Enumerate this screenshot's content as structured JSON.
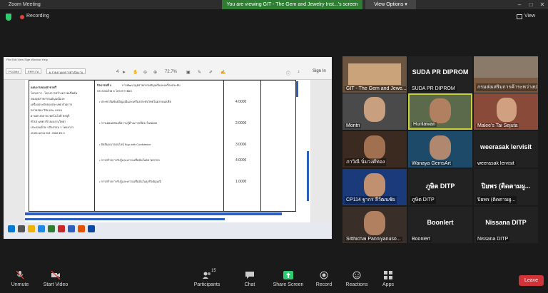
{
  "window": {
    "title": "Zoom Meeting",
    "share_banner": "You are viewing GIT - The Gem and Jewelry Inst...'s screen",
    "view_options": "View Options",
    "min": "–",
    "max": "□",
    "close": "✕"
  },
  "meeting": {
    "recording": "Recording",
    "view_label": "View"
  },
  "shared_doc": {
    "signin": "Sign In",
    "zoom_pct": "72.7%",
    "page_num": "4",
    "tab1": "PC0094",
    "tab2": "ERR ITA",
    "tab3": "ผ.รายงานผลการดำเนินงาน",
    "left_header": "แผนงานของสาขาตรี",
    "left_lines": [
      "โครงการ : โครงการสร้างความเชื่อมั่น",
      "ของอุตสาหกรรมอัญมณีและ",
      "เครื่องประดับของประเทศ ด้วยการ",
      "ตรวจสอบ วิจัย และ อบรม",
      "ผ่านทางหลาย เทคโนโลยี ชลบุรี",
      "ทั่วประเทศ สร้างผลงานวิทยา",
      "ประกอบด้วย ฯ กิจกรรม ฯ โครงการ",
      "งบประมาณ พ.ศ. 2566 ตร.3"
    ],
    "activity_header": "กิจกรรมที่ 3",
    "activity_title": "การพัฒนาอุตสาหกรรมอัญมณีและเครื่องประดับ",
    "activity_sub": "ประกอบด้วย 5 โครงการย่อย",
    "bullets": [
      "• ประชาสัมพันธ์อัญมณีและเครื่องประดับไทยในตลาดเอเชีย",
      "• การเผยแพร่องค์ความรู้ด้านการเจียระไนพลอย",
      "• จัดสัมมนาออนไลน์ Buy with Confidence",
      "• การสร้างการรับรู้และความเชื่อมั่นในตลาดสากล",
      "• การสร้างการรับรู้และความเชื่อมั่นในธุรกิจอัญมณี"
    ],
    "values": [
      "4.0000",
      "2.0000",
      "3.0000",
      "4.0000",
      "1.0000"
    ]
  },
  "participants": [
    {
      "name": "GIT - The Gem and Jewe...",
      "big": ""
    },
    {
      "name": "SUDA PR DIPROM",
      "big": "SUDA PR DIPROM"
    },
    {
      "name": "กรมส่งเสริมการค้าระหว่างประเทศ",
      "big": ""
    },
    {
      "name": "Montri",
      "big": ""
    },
    {
      "name": "Hunlawan",
      "big": ""
    },
    {
      "name": "Malee's Tai Sejuta",
      "big": ""
    },
    {
      "name": "ภาวิณี นิ่มวงศ์ทอง",
      "big": ""
    },
    {
      "name": "Wanaya GemsArt",
      "big": ""
    },
    {
      "name": "weerasak lervisit",
      "big": "weerasak lervisit"
    },
    {
      "name": "CP114 ฐากร ลีวัฒนชัย",
      "big": ""
    },
    {
      "name": "ภูษิต DITP",
      "big": "ภูษิต DITP"
    },
    {
      "name": "ปิยพร (ติดตามผู...",
      "big": "ปิยพร (ติดตามผู..."
    },
    {
      "name": "Sitthichai Panniyanuso...",
      "big": ""
    },
    {
      "name": "Boonlert",
      "big": "Boonlert"
    },
    {
      "name": "Nissana DITP",
      "big": "Nissana DITP"
    }
  ],
  "toolbar": {
    "unmute": "Unmute",
    "start_video": "Start Video",
    "participants": "Participants",
    "participants_count": "15",
    "chat": "Chat",
    "share_screen": "Share Screen",
    "record": "Record",
    "reactions": "Reactions",
    "apps": "Apps",
    "leave": "Leave"
  },
  "colors": {
    "share_green": "#2e7d32",
    "leave_red": "#d13438",
    "active_speaker": "#c9d23a",
    "doc_blue": "#2d5fbf"
  }
}
